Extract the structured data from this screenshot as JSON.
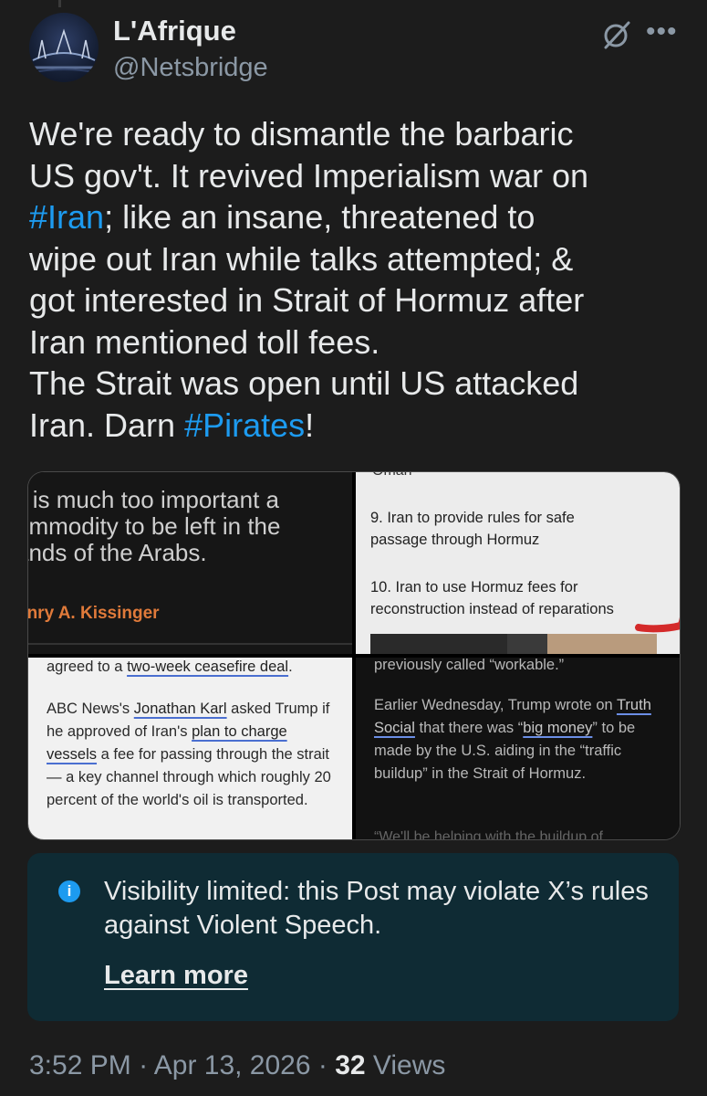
{
  "post": {
    "display_name": "L'Afrique",
    "handle": "@Netsbridge",
    "text_parts": {
      "t1": "We're ready to dismantle the barbaric\nUS gov't. It revived Imperialism war on\n",
      "hashtag_iran": "#Iran",
      "t2": "; like an insane, threatened to\nwipe out Iran while talks attempted; &\ngot interested in Strait of Hormuz after\nIran mentioned toll fees.\nThe Strait was open until US attacked\nIran. Darn ",
      "hashtag_pirates": "#Pirates",
      "t3": "!"
    }
  },
  "media": {
    "panel1": {
      "quote": "il is much too important a\nommodity to be left in the\nands of the Arabs.",
      "author": "enry A. Kissinger"
    },
    "panel2": {
      "top_cut": "Oman",
      "point9": "9. Iran to provide rules for safe\npassage through Hormuz",
      "point10": "10. Iran to use Hormuz fees for\nreconstruction instead of reparations"
    },
    "panel3": {
      "line1_pre": "agreed to a ",
      "line1_link": "two-week ceasefire deal",
      "line1_post": ".",
      "p_a": "ABC News's ",
      "p_link1": "Jonathan Karl",
      "p_b": " asked Trump if he approved of Iran's ",
      "p_link2": "plan to charge vessels",
      "p_c": " a fee for passing through the strait — a key channel through which roughly 20 percent of the world's oil is transported."
    },
    "panel4": {
      "top": "previously called “workable.”",
      "p_a": "Earlier Wednesday, Trump wrote on ",
      "p_link1": "Truth Social",
      "p_b": " that there was “",
      "p_link2": "big money",
      "p_c": "” to be made by the U.S. aiding in the “traffic buildup” in the Strait of Hormuz.",
      "bottom_cut": "“We'll be helping with the buildup of"
    }
  },
  "notice": {
    "icon": "info-icon",
    "text": "Visibility limited: this Post may violate X’s rules against Violent Speech.",
    "link": "Learn more"
  },
  "meta": {
    "time": "3:52 PM",
    "sep1": " · ",
    "date": "Apr 13, 2026",
    "sep2": " · ",
    "views_count": "32",
    "views_label": " Views"
  },
  "colors": {
    "background": "#1c1c1c",
    "hashtag": "#1d9bf0",
    "notice_bg": "#0f2b34",
    "kissinger_orange": "#e07a3a",
    "marker_red": "#d42a2a"
  }
}
